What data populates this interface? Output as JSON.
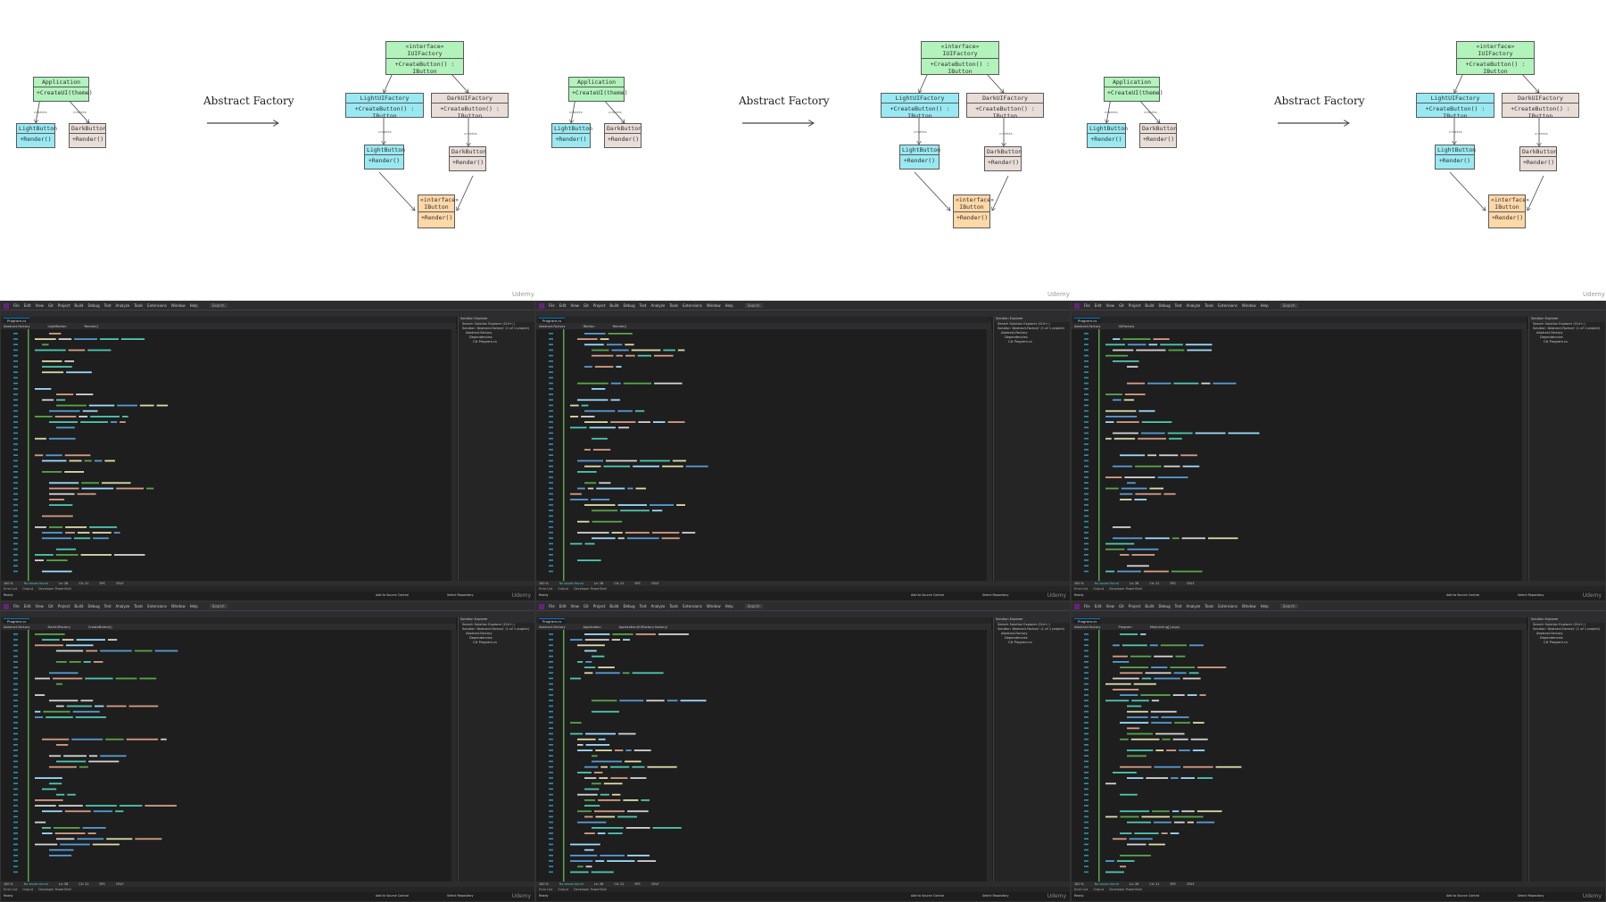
{
  "diagram": {
    "title": "Abstract Factory",
    "watermark": "Udemy",
    "application": {
      "name": "Application",
      "method": "+CreateUI(theme)"
    },
    "simple_light": {
      "name": "LightButton",
      "method": "+Render()"
    },
    "simple_dark": {
      "name": "DarkButton",
      "method": "+Render()"
    },
    "uifactory": {
      "stereotype": "«interface»",
      "name": "IUIFactory",
      "method": "+CreateButton() : IButton"
    },
    "light_factory": {
      "name": "LightUIFactory",
      "method": "+CreateButton() : IButton"
    },
    "dark_factory": {
      "name": "DarkUIFactory",
      "method": "+CreateButton() : IButton"
    },
    "light_button": {
      "name": "LightButton",
      "method": "+Render()"
    },
    "dark_button": {
      "name": "DarkButton",
      "method": "+Render()"
    },
    "ibutton": {
      "stereotype": "«interface»",
      "name": "IButton",
      "method": "+Render()"
    },
    "rel_label": "creates"
  },
  "ide": {
    "menu": [
      "File",
      "Edit",
      "View",
      "Git",
      "Project",
      "Build",
      "Debug",
      "Test",
      "Analyze",
      "Tools",
      "Extensions",
      "Window",
      "Help"
    ],
    "search": "Search",
    "solution_explorer": {
      "title": "Solution Explorer",
      "search": "Search Solution Explorer (Ctrl+;)",
      "items": [
        "Solution 'Abstract-Factory' (1 of 1 project)",
        "Abstract-Factory",
        "Dependencies",
        "C# Program.cs"
      ]
    },
    "status": {
      "zoom": "100 %",
      "issues": "No issues found",
      "ln": "Ln: 28",
      "ch": "Ch: 21",
      "spc": "SPC",
      "crlf": "CRLF"
    },
    "bottom_tabs": [
      "Error List",
      "Output",
      "Developer PowerShell"
    ],
    "bottom_bar": {
      "ready": "Ready",
      "source_control": "Add to Source Control",
      "repo": "Select Repository"
    },
    "watermark": "Udemy",
    "windows": [
      {
        "tab": "Program.cs",
        "file": "Abstract-Factory",
        "nav2": "LightButton",
        "nav3": "Render()"
      },
      {
        "tab": "Program.cs",
        "file": "Abstract-Factory",
        "nav2": "IButton",
        "nav3": "Render()"
      },
      {
        "tab": "Program.cs",
        "file": "Abstract-Factory",
        "nav2": "IUIFactory",
        "nav3": ""
      },
      {
        "tab": "Program.cs",
        "file": "Abstract-Factory",
        "nav2": "DarkUIFactory",
        "nav3": "CreateButton()"
      },
      {
        "tab": "Program.cs",
        "file": "Abstract-Factory",
        "nav2": "Application",
        "nav3": "Application(IUIFactory factory)"
      },
      {
        "tab": "Program.cs",
        "file": "Abstract-Factory",
        "nav2": "Program",
        "nav3": "Main(string[] args)"
      }
    ]
  }
}
